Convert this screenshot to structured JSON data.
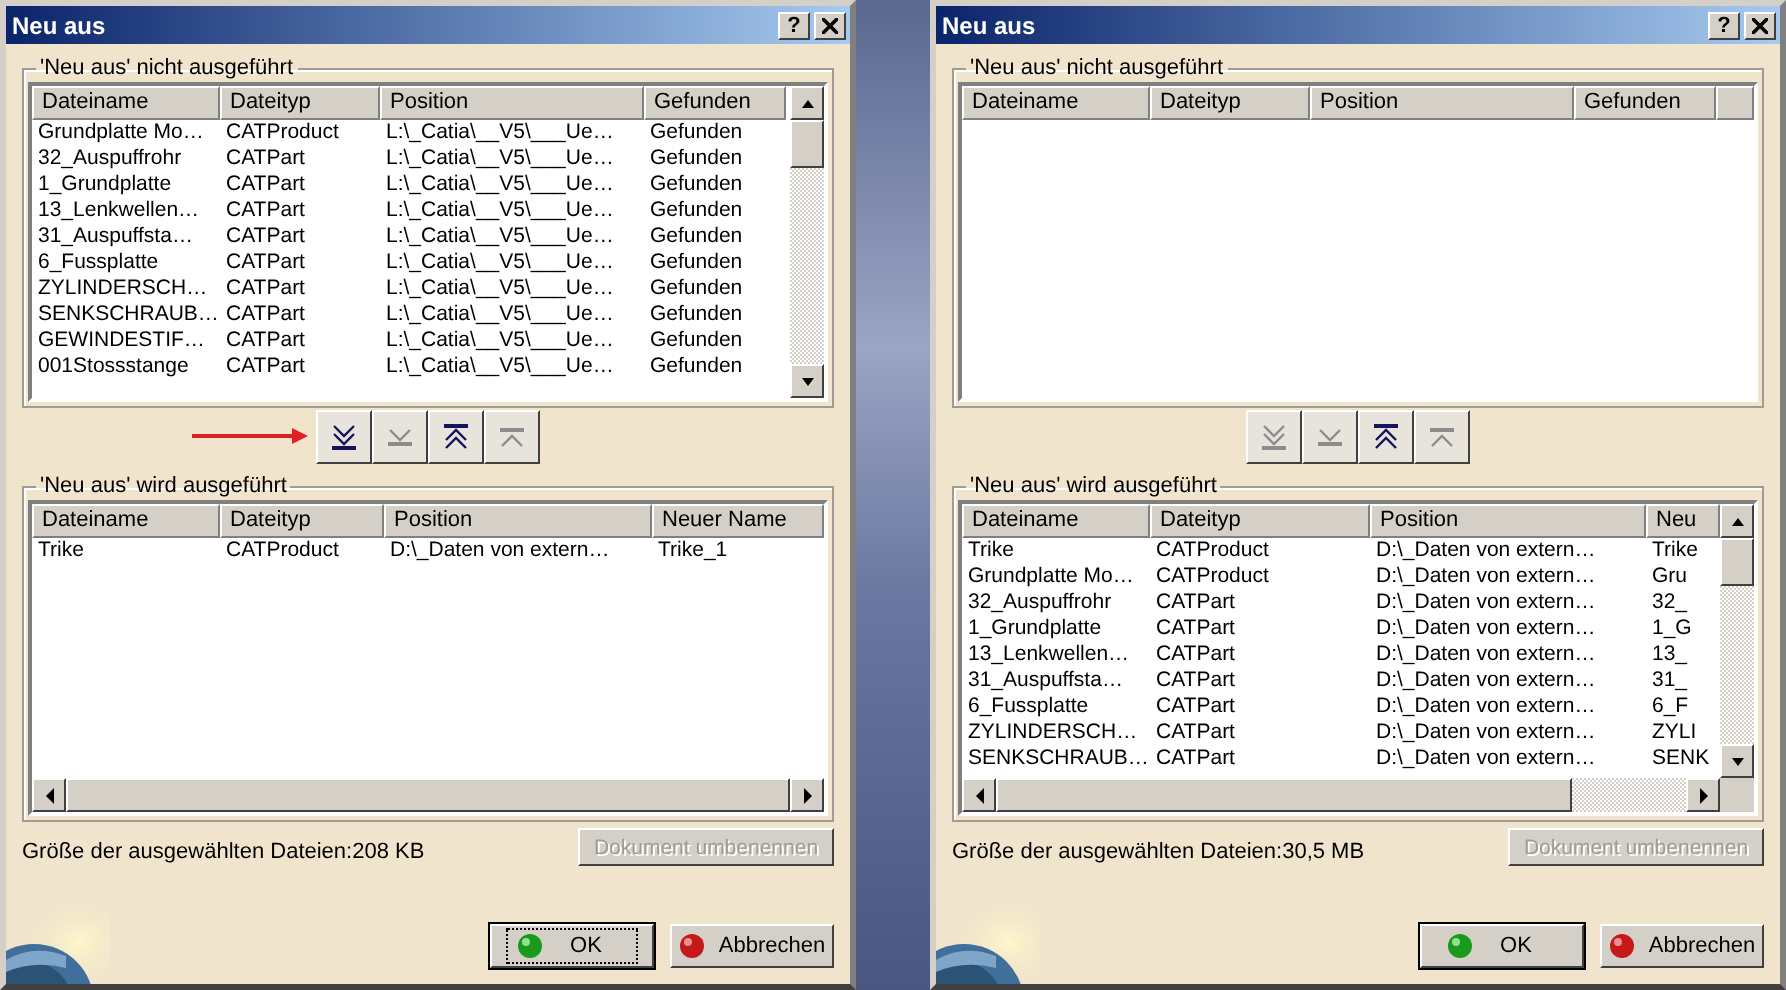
{
  "dialogs": [
    {
      "title": "Neu aus",
      "help_label": "?",
      "pointer_arrow": true,
      "pending_group": {
        "label": "'Neu aus' nicht ausgeführt",
        "columns": [
          "Dateiname",
          "Dateityp",
          "Position",
          "Gefunden"
        ],
        "rows": [
          [
            "Grundplatte Mo…",
            "CATProduct",
            "L:\\_Catia\\__V5\\___Ue…",
            "Gefunden"
          ],
          [
            "32_Auspuffrohr",
            "CATPart",
            "L:\\_Catia\\__V5\\___Ue…",
            "Gefunden"
          ],
          [
            "1_Grundplatte",
            "CATPart",
            "L:\\_Catia\\__V5\\___Ue…",
            "Gefunden"
          ],
          [
            "13_Lenkwellen…",
            "CATPart",
            "L:\\_Catia\\__V5\\___Ue…",
            "Gefunden"
          ],
          [
            "31_Auspuffsta…",
            "CATPart",
            "L:\\_Catia\\__V5\\___Ue…",
            "Gefunden"
          ],
          [
            "6_Fussplatte",
            "CATPart",
            "L:\\_Catia\\__V5\\___Ue…",
            "Gefunden"
          ],
          [
            "ZYLINDERSCH…",
            "CATPart",
            "L:\\_Catia\\__V5\\___Ue…",
            "Gefunden"
          ],
          [
            "SENKSCHRAUB…",
            "CATPart",
            "L:\\_Catia\\__V5\\___Ue…",
            "Gefunden"
          ],
          [
            "GEWINDESTIF…",
            "CATPart",
            "L:\\_Catia\\__V5\\___Ue…",
            "Gefunden"
          ],
          [
            "001Stossstange",
            "CATPart",
            "L:\\_Catia\\__V5\\___Ue…",
            "Gefunden"
          ]
        ]
      },
      "move_buttons": [
        {
          "kind": "all_down",
          "disabled": false
        },
        {
          "kind": "down",
          "disabled": true
        },
        {
          "kind": "all_up",
          "disabled": false
        },
        {
          "kind": "up",
          "disabled": true
        }
      ],
      "done_group": {
        "label": "'Neu aus' wird ausgeführt",
        "columns": [
          "Dateiname",
          "Dateityp",
          "Position",
          "Neuer Name"
        ],
        "rows": [
          [
            "Trike",
            "CATProduct",
            "D:\\_Daten von extern…",
            "Trike_1"
          ]
        ]
      },
      "size_info": "Größe der ausgewählten Dateien:208 KB",
      "rename_button": {
        "label": "Dokument umbenennen",
        "disabled": true
      },
      "ok_button": {
        "label": "OK",
        "focused": true
      },
      "cancel_button": {
        "label": "Abbrechen"
      }
    },
    {
      "title": "Neu aus",
      "help_label": "?",
      "pointer_arrow": false,
      "pending_group": {
        "label": "'Neu aus' nicht ausgeführt",
        "columns": [
          "Dateiname",
          "Dateityp",
          "Position",
          "Gefunden"
        ]
      },
      "move_buttons": [
        {
          "kind": "all_down",
          "disabled": true
        },
        {
          "kind": "down",
          "disabled": true
        },
        {
          "kind": "all_up",
          "disabled": false
        },
        {
          "kind": "up",
          "disabled": true
        }
      ],
      "done_group": {
        "label": "'Neu aus' wird ausgeführt",
        "columns": [
          "Dateiname",
          "Dateityp",
          "Position",
          "Neu"
        ],
        "rows": [
          [
            "Trike",
            "CATProduct",
            "D:\\_Daten von extern…",
            "Trike"
          ],
          [
            "Grundplatte Mo…",
            "CATProduct",
            "D:\\_Daten von extern…",
            "Gru"
          ],
          [
            "32_Auspuffrohr",
            "CATPart",
            "D:\\_Daten von extern…",
            "32_"
          ],
          [
            "1_Grundplatte",
            "CATPart",
            "D:\\_Daten von extern…",
            "1_G"
          ],
          [
            "13_Lenkwellen…",
            "CATPart",
            "D:\\_Daten von extern…",
            "13_"
          ],
          [
            "31_Auspuffsta…",
            "CATPart",
            "D:\\_Daten von extern…",
            "31_"
          ],
          [
            "6_Fussplatte",
            "CATPart",
            "D:\\_Daten von extern…",
            "6_F"
          ],
          [
            "ZYLINDERSCH…",
            "CATPart",
            "D:\\_Daten von extern…",
            "ZYLI"
          ],
          [
            "SENKSCHRAUB…",
            "CATPart",
            "D:\\_Daten von extern…",
            "SENK"
          ]
        ]
      },
      "size_info": "Größe der ausgewählten Dateien:30,5 MB",
      "rename_button": {
        "label": "Dokument umbenennen",
        "disabled": true
      },
      "ok_button": {
        "label": "OK",
        "focused": false
      },
      "cancel_button": {
        "label": "Abbrechen"
      }
    }
  ]
}
